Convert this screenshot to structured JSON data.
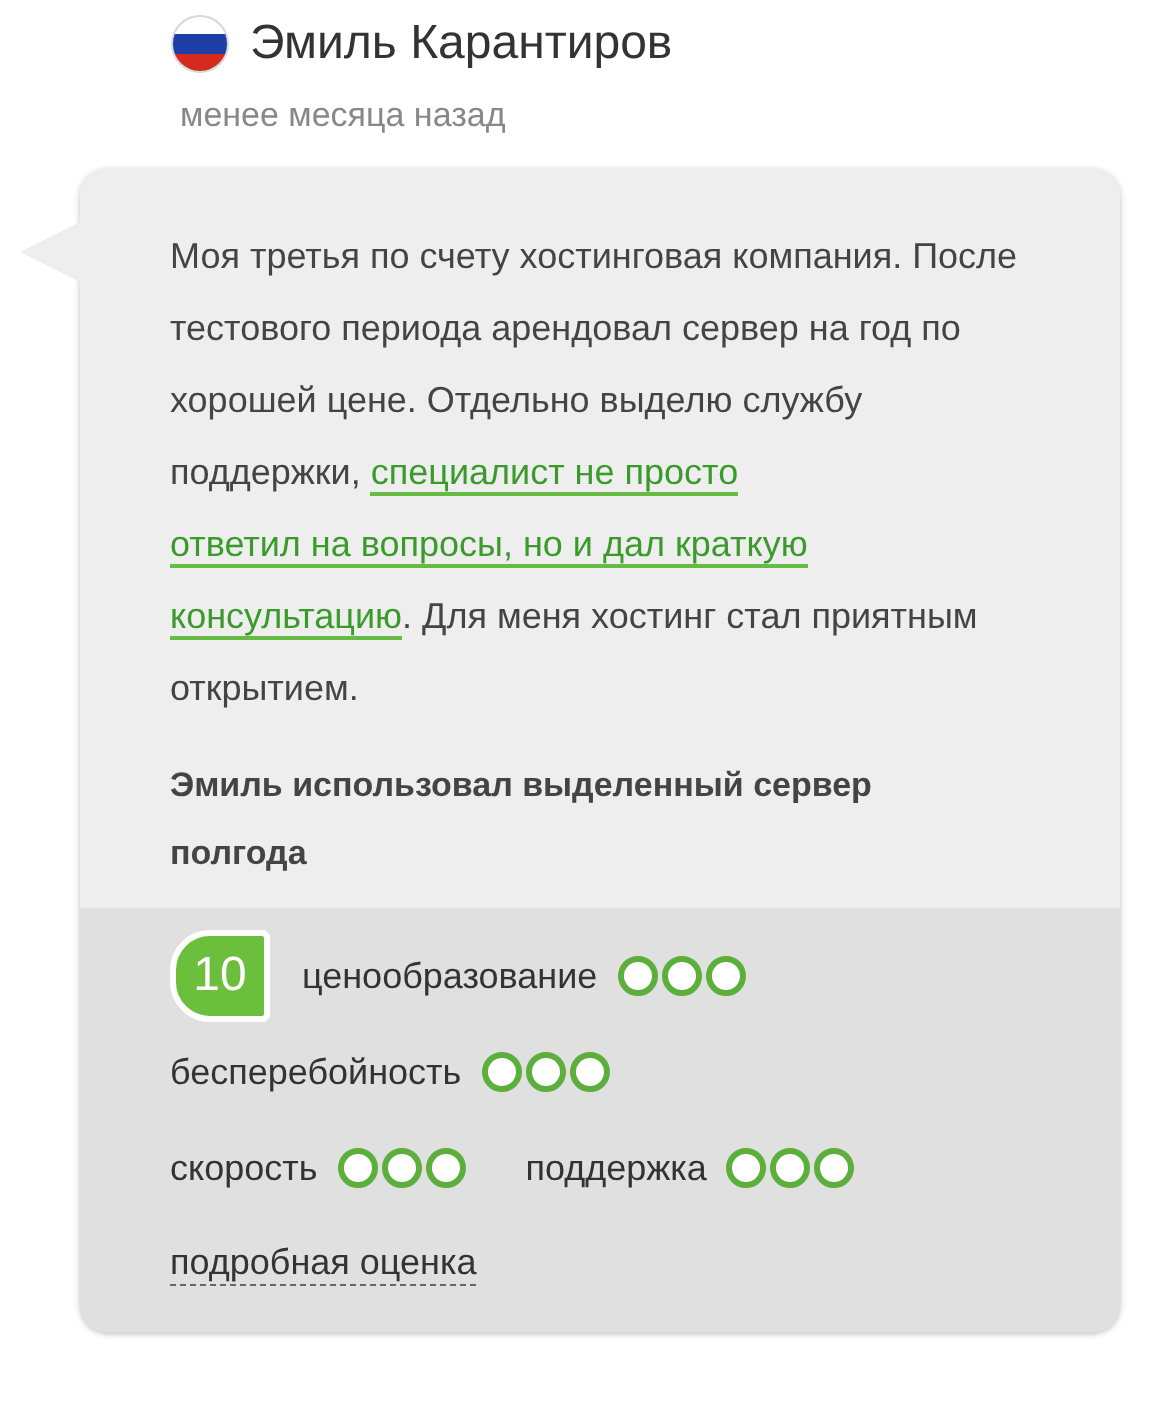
{
  "author": {
    "name": "Эмиль Карантиров",
    "date": "менее месяца назад"
  },
  "review": {
    "parts": [
      {
        "kind": "text",
        "text": "Моя третья по счету хостинговая компания. После тестового периода арендовал сервер на год по хорошей цене. Отдельно выделю службу поддержки, "
      },
      {
        "kind": "link",
        "text": "специалист не просто"
      },
      {
        "kind": "link",
        "text": "ответил на вопросы, но и дал краткую"
      },
      {
        "kind": "link",
        "text": "консультацию"
      },
      {
        "kind": "text",
        "text": ". Для меня хостинг стал приятным открытием."
      }
    ],
    "usage": "Эмиль использовал выделенный сервер полгода"
  },
  "ratings": {
    "score": "10",
    "items": [
      {
        "label": "ценообразование"
      },
      {
        "label": "бесперебойность"
      },
      {
        "label": "скорость"
      },
      {
        "label": "поддержка"
      }
    ],
    "details_link": "подробная оценка"
  }
}
